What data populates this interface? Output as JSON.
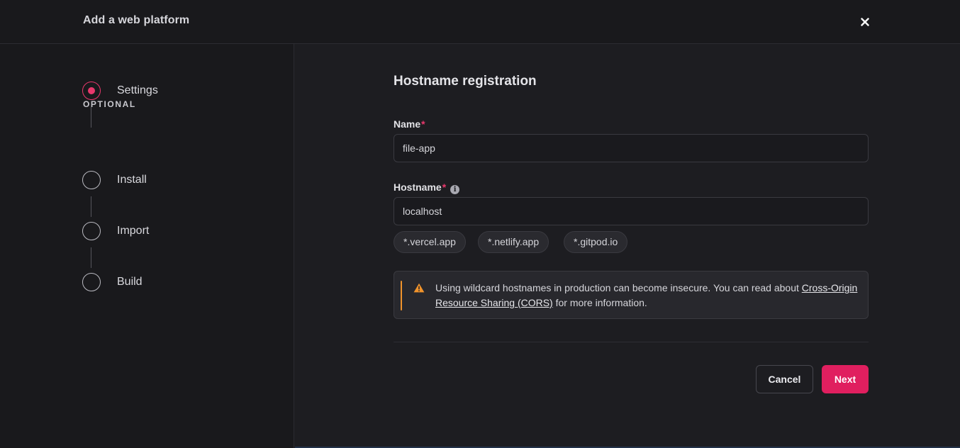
{
  "modal": {
    "title": "Add a web platform",
    "close_icon": "close-icon"
  },
  "steps": {
    "optional_heading": "OPTIONAL",
    "items": [
      {
        "label": "Settings",
        "state": "active"
      },
      {
        "label": "Install",
        "state": "inactive"
      },
      {
        "label": "Import",
        "state": "inactive"
      },
      {
        "label": "Build",
        "state": "inactive"
      }
    ]
  },
  "form": {
    "section_title": "Hostname registration",
    "name": {
      "label": "Name",
      "required_mark": "*",
      "value": "file-app"
    },
    "hostname": {
      "label": "Hostname",
      "required_mark": "*",
      "info_icon": "info-icon",
      "value": "localhost",
      "suggestions": [
        "*.vercel.app",
        "*.netlify.app",
        "*.gitpod.io"
      ]
    },
    "alert": {
      "icon": "warning-icon",
      "text_before": "Using wildcard hostnames in production can become insecure. You can read about ",
      "link_text": "Cross-Origin Resource Sharing (CORS)",
      "text_after": " for more information."
    }
  },
  "actions": {
    "cancel_label": "Cancel",
    "next_label": "Next"
  },
  "colors": {
    "accent": "#e01f5f",
    "active_step": "#e8386c",
    "warning": "#f0932b",
    "background": "#1d1d21",
    "sidebar": "#19191c"
  }
}
